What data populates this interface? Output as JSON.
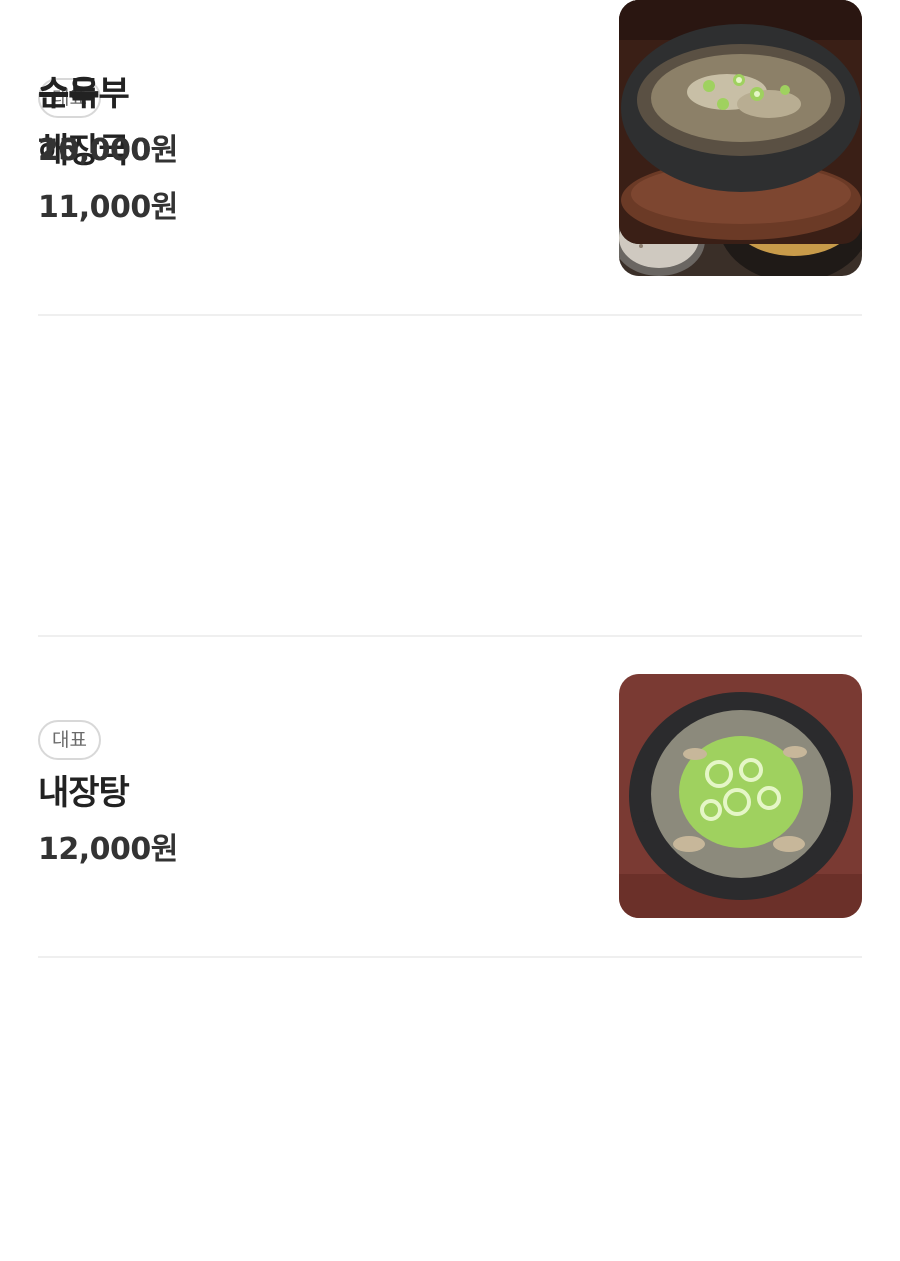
{
  "menu": {
    "items": [
      {
        "badge": "대표",
        "name": "해장국",
        "price": "11,000원",
        "image_icon": "haejangguk-photo"
      },
      {
        "badge": "대표",
        "name": "내장탕",
        "price": "12,000원",
        "image_icon": "naejangtang-photo"
      },
      {
        "badge": "",
        "name": "순두부",
        "price": "10,000원",
        "image_icon": "sundubu-photo"
      },
      {
        "badge": "",
        "name": "수육",
        "price": "25,000원",
        "image_icon": "suyuk-photo"
      }
    ]
  },
  "colors": {
    "badge_border": "#d8d8d8",
    "badge_text": "#6b6b6b",
    "divider": "#efefef",
    "text": "#222222"
  }
}
